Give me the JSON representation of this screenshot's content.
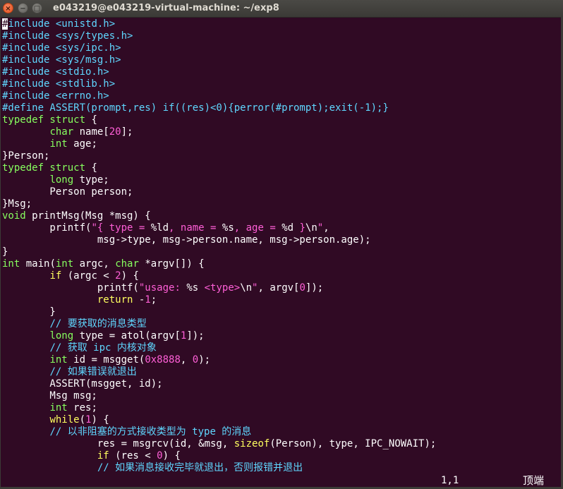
{
  "window": {
    "title": "e043219@e043219-virtual-machine: ~/exp8",
    "close_glyph": "×",
    "min_glyph": "−",
    "max_glyph": "□"
  },
  "code": {
    "lines": [
      [
        {
          "t": "#",
          "c": "cursor"
        },
        {
          "t": "include <unistd.h>",
          "c": "pp"
        }
      ],
      [
        {
          "t": "#include <sys/types.h>",
          "c": "pp"
        }
      ],
      [
        {
          "t": "#include <sys/ipc.h>",
          "c": "pp"
        }
      ],
      [
        {
          "t": "#include <sys/msg.h>",
          "c": "pp"
        }
      ],
      [
        {
          "t": "#include <stdio.h>",
          "c": "pp"
        }
      ],
      [
        {
          "t": "#include <stdlib.h>",
          "c": "pp"
        }
      ],
      [
        {
          "t": "#include <errno.h>",
          "c": "pp"
        }
      ],
      [
        {
          "t": "#define ASSERT(prompt,res) if((res)<0){perror(#prompt);exit(-1);}",
          "c": "pp"
        }
      ],
      [
        {
          "t": "typedef struct",
          "c": "ty"
        },
        {
          "t": " {",
          "c": ""
        }
      ],
      [
        {
          "t": "        ",
          "c": ""
        },
        {
          "t": "char",
          "c": "ty"
        },
        {
          "t": " name[",
          "c": ""
        },
        {
          "t": "20",
          "c": "nm"
        },
        {
          "t": "];",
          "c": ""
        }
      ],
      [
        {
          "t": "        ",
          "c": ""
        },
        {
          "t": "int",
          "c": "ty"
        },
        {
          "t": " age;",
          "c": ""
        }
      ],
      [
        {
          "t": "}Person;",
          "c": ""
        }
      ],
      [
        {
          "t": "typedef struct",
          "c": "ty"
        },
        {
          "t": " {",
          "c": ""
        }
      ],
      [
        {
          "t": "        ",
          "c": ""
        },
        {
          "t": "long",
          "c": "ty"
        },
        {
          "t": " type;",
          "c": ""
        }
      ],
      [
        {
          "t": "        Person person;",
          "c": ""
        }
      ],
      [
        {
          "t": "}Msg;",
          "c": ""
        }
      ],
      [
        {
          "t": "void",
          "c": "ty"
        },
        {
          "t": " printMsg(Msg *msg) {",
          "c": ""
        }
      ],
      [
        {
          "t": "        printf(",
          "c": ""
        },
        {
          "t": "\"{ type = ",
          "c": "st"
        },
        {
          "t": "%ld",
          "c": ""
        },
        {
          "t": ", name = ",
          "c": "st"
        },
        {
          "t": "%s",
          "c": ""
        },
        {
          "t": ", age = ",
          "c": "st"
        },
        {
          "t": "%d",
          "c": ""
        },
        {
          "t": " }",
          "c": "st"
        },
        {
          "t": "\\n",
          "c": ""
        },
        {
          "t": "\"",
          "c": "st"
        },
        {
          "t": ",",
          "c": ""
        }
      ],
      [
        {
          "t": "                msg->type, msg->person.name, msg->person.age);",
          "c": ""
        }
      ],
      [
        {
          "t": "}",
          "c": ""
        }
      ],
      [
        {
          "t": "int",
          "c": "ty"
        },
        {
          "t": " main(",
          "c": ""
        },
        {
          "t": "int",
          "c": "ty"
        },
        {
          "t": " argc, ",
          "c": ""
        },
        {
          "t": "char",
          "c": "ty"
        },
        {
          "t": " *argv[]) {",
          "c": ""
        }
      ],
      [
        {
          "t": "        ",
          "c": ""
        },
        {
          "t": "if",
          "c": "kw"
        },
        {
          "t": " (argc < ",
          "c": ""
        },
        {
          "t": "2",
          "c": "nm"
        },
        {
          "t": ") {",
          "c": ""
        }
      ],
      [
        {
          "t": "                printf(",
          "c": ""
        },
        {
          "t": "\"usage: ",
          "c": "st"
        },
        {
          "t": "%s",
          "c": ""
        },
        {
          "t": " <type>",
          "c": "st"
        },
        {
          "t": "\\n",
          "c": ""
        },
        {
          "t": "\"",
          "c": "st"
        },
        {
          "t": ", argv[",
          "c": ""
        },
        {
          "t": "0",
          "c": "nm"
        },
        {
          "t": "]);",
          "c": ""
        }
      ],
      [
        {
          "t": "                ",
          "c": ""
        },
        {
          "t": "return",
          "c": "kw"
        },
        {
          "t": " -",
          "c": ""
        },
        {
          "t": "1",
          "c": "nm"
        },
        {
          "t": ";",
          "c": ""
        }
      ],
      [
        {
          "t": "        }",
          "c": ""
        }
      ],
      [
        {
          "t": "        ",
          "c": ""
        },
        {
          "t": "// 要获取的消息类型",
          "c": "cm"
        }
      ],
      [
        {
          "t": "        ",
          "c": ""
        },
        {
          "t": "long",
          "c": "ty"
        },
        {
          "t": " type = atol(argv[",
          "c": ""
        },
        {
          "t": "1",
          "c": "nm"
        },
        {
          "t": "]);",
          "c": ""
        }
      ],
      [
        {
          "t": "        ",
          "c": ""
        },
        {
          "t": "// 获取 ipc 内核对象",
          "c": "cm"
        }
      ],
      [
        {
          "t": "        ",
          "c": ""
        },
        {
          "t": "int",
          "c": "ty"
        },
        {
          "t": " id = msgget(",
          "c": ""
        },
        {
          "t": "0x8888",
          "c": "nm"
        },
        {
          "t": ", ",
          "c": ""
        },
        {
          "t": "0",
          "c": "nm"
        },
        {
          "t": ");",
          "c": ""
        }
      ],
      [
        {
          "t": "        ",
          "c": ""
        },
        {
          "t": "// 如果错误就退出",
          "c": "cm"
        }
      ],
      [
        {
          "t": "        ASSERT(msgget, id);",
          "c": ""
        }
      ],
      [
        {
          "t": "        Msg msg;",
          "c": ""
        }
      ],
      [
        {
          "t": "        ",
          "c": ""
        },
        {
          "t": "int",
          "c": "ty"
        },
        {
          "t": " res;",
          "c": ""
        }
      ],
      [
        {
          "t": "        ",
          "c": ""
        },
        {
          "t": "while",
          "c": "kw"
        },
        {
          "t": "(",
          "c": ""
        },
        {
          "t": "1",
          "c": "nm"
        },
        {
          "t": ") {",
          "c": ""
        }
      ],
      [
        {
          "t": "        ",
          "c": ""
        },
        {
          "t": "// 以非阻塞的方式接收类型为 type 的消息",
          "c": "cm"
        }
      ],
      [
        {
          "t": "                res = msgrcv(id, &msg, ",
          "c": ""
        },
        {
          "t": "sizeof",
          "c": "kw"
        },
        {
          "t": "(Person), type, IPC_NOWAIT);",
          "c": ""
        }
      ],
      [
        {
          "t": "                ",
          "c": ""
        },
        {
          "t": "if",
          "c": "kw"
        },
        {
          "t": " (res < ",
          "c": ""
        },
        {
          "t": "0",
          "c": "nm"
        },
        {
          "t": ") {",
          "c": ""
        }
      ],
      [
        {
          "t": "                ",
          "c": ""
        },
        {
          "t": "// 如果消息接收完毕就退出，否则报错并退出",
          "c": "cm"
        }
      ]
    ]
  },
  "status": {
    "position": "1,1",
    "scroll": "顶端"
  }
}
